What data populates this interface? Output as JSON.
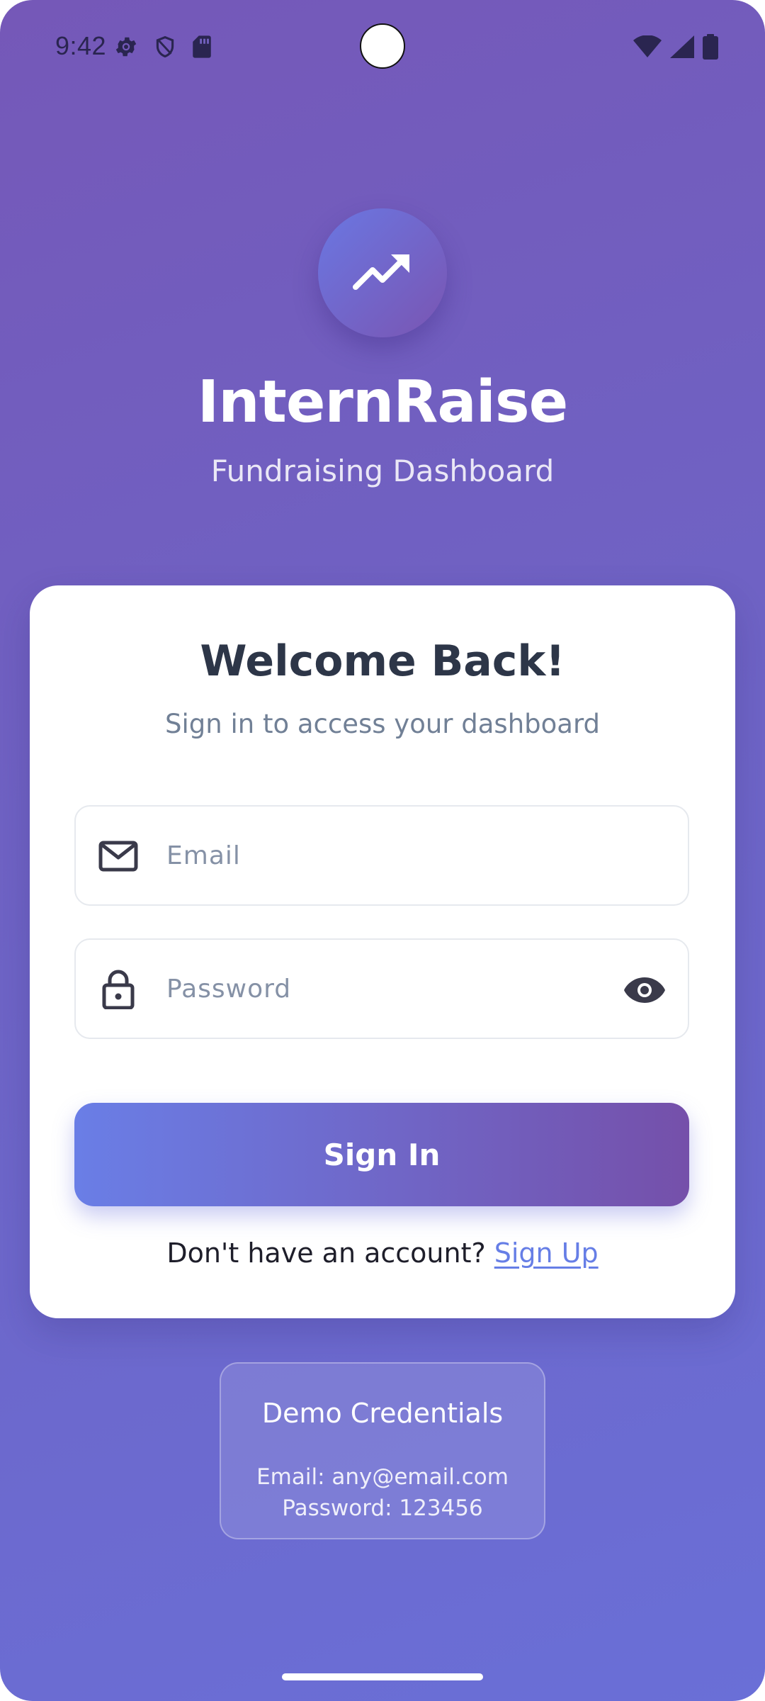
{
  "status_bar": {
    "time": "9:42",
    "left_icons": [
      "settings-icon",
      "shield-icon",
      "sd-card-icon"
    ],
    "right_icons": [
      "wifi-icon",
      "signal-icon",
      "battery-icon"
    ]
  },
  "header": {
    "logo_icon": "trending-up-icon",
    "title": "InternRaise",
    "subtitle": "Fundraising Dashboard"
  },
  "login_card": {
    "title": "Welcome Back!",
    "subtitle": "Sign in to access your dashboard",
    "email": {
      "icon": "mail-icon",
      "placeholder": "Email",
      "value": ""
    },
    "password": {
      "icon": "lock-icon",
      "placeholder": "Password",
      "value": "",
      "toggle_icon": "eye-icon"
    },
    "submit_label": "Sign In",
    "signup_prompt": "Don't have an account?",
    "signup_link": "Sign Up"
  },
  "demo": {
    "title": "Demo Credentials",
    "email_line": "Email: any@email.com",
    "password_line": "Password: 123456"
  },
  "colors": {
    "background_start": "#7558b8",
    "background_end": "#6a6fd7",
    "button_start": "#6a7ee6",
    "button_end": "#7550aa",
    "link": "#667ee6",
    "title_text": "#2d3648",
    "muted_text": "#718096"
  }
}
